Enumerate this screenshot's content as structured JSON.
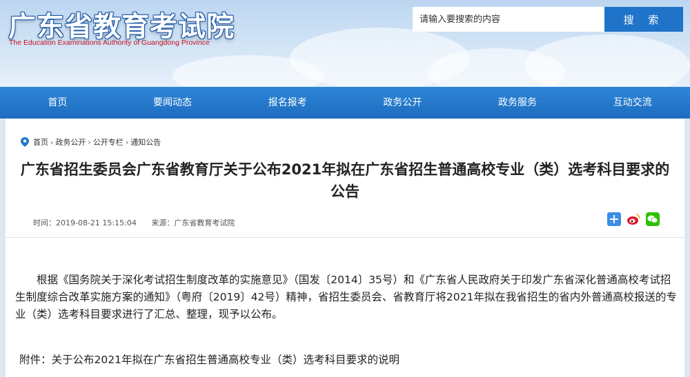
{
  "header": {
    "site_title": "广东省教育考试院",
    "site_subtitle": "The Education Examinations Authority of Guangdong Province",
    "search_placeholder": "请输入要搜索的内容",
    "search_button": "搜 索"
  },
  "nav": {
    "items": [
      "首页",
      "要闻动态",
      "报名报考",
      "政务公开",
      "政务服务",
      "互动交流"
    ]
  },
  "breadcrumb": [
    "首页",
    "政务公开",
    "公开专栏",
    "通知公告"
  ],
  "article": {
    "title": "广东省招生委员会广东省教育厅关于公布2021年拟在广东省招生普通高校专业（类）选考科目要求的公告",
    "time": "时间：2019-08-21 15:15:04",
    "source": "来源：广东省教育考试院",
    "body": "根据《国务院关于深化考试招生制度改革的实施意见》（国发〔2014〕35号）和《广东省人民政府关于印发广东省深化普通高校考试招生制度综合改革实施方案的通知》（粤府〔2019〕42号）精神，省招生委员会、省教育厅将2021年拟在我省招生的省内外普通高校报送的专业（类）选考科目要求进行了汇总、整理，现予以公布。",
    "attachment": "附件：关于公布2021年拟在广东省招生普通高校专业（类）选考科目要求的说明"
  },
  "share_icons": [
    "plus-share-icon",
    "weibo-icon",
    "wechat-icon"
  ],
  "colors": {
    "nav": "#2377cc",
    "search_button": "#1f74c9",
    "subtitle": "#c8101e"
  }
}
